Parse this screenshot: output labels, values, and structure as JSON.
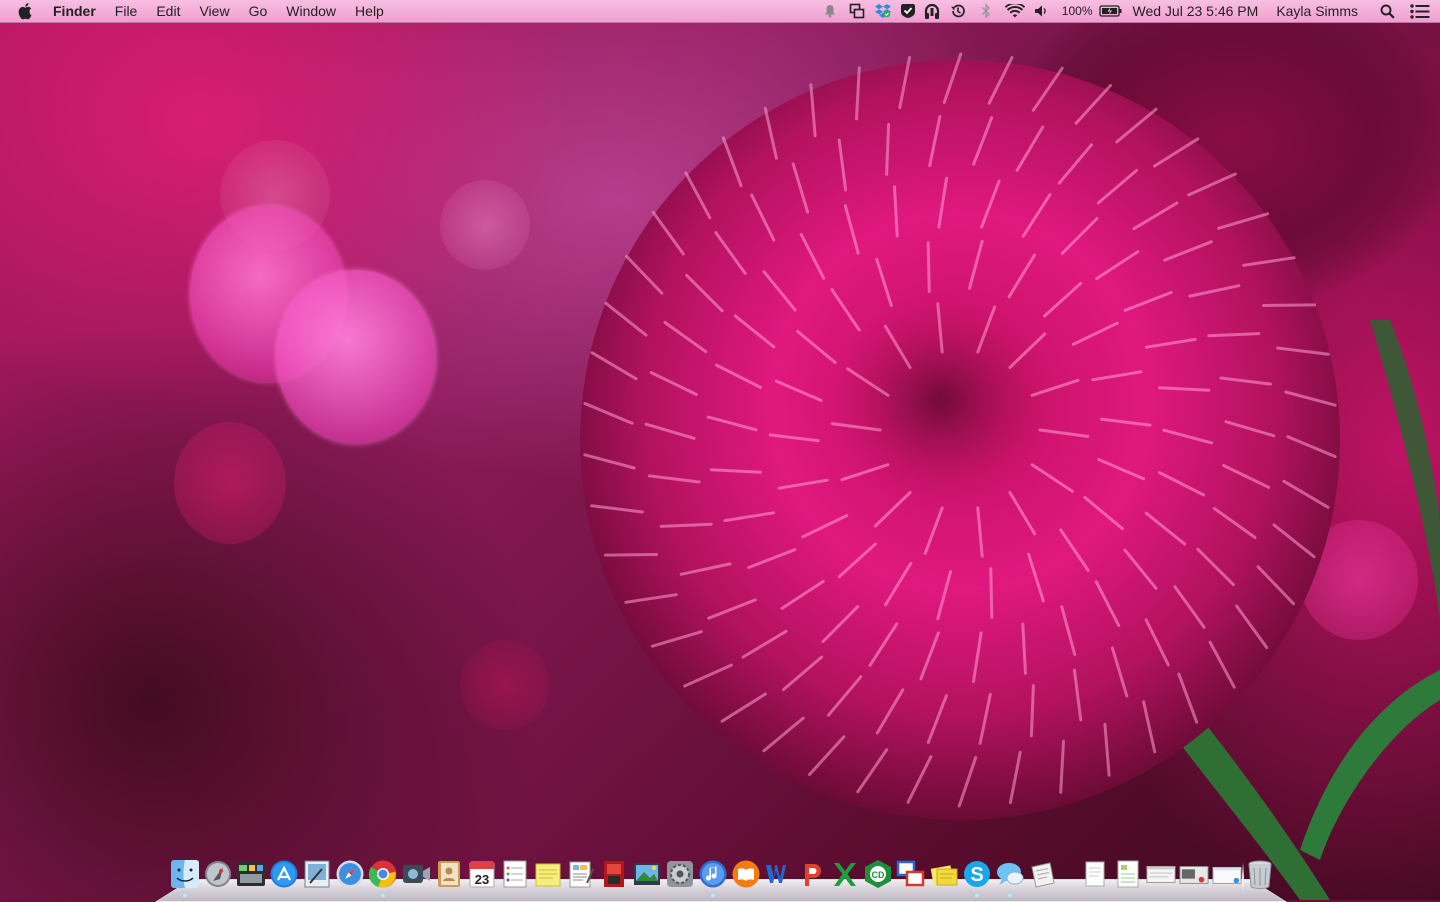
{
  "menubar": {
    "app_name": "Finder",
    "menus": [
      "File",
      "Edit",
      "View",
      "Go",
      "Window",
      "Help"
    ],
    "status": {
      "battery": "100%",
      "datetime": "Wed Jul 23  5:46 PM",
      "user": "Kayla Simms"
    },
    "status_icons": [
      "notification-bell-icon",
      "screen-share-icon",
      "dropbox-icon",
      "check-shield-icon",
      "headphone-app-icon",
      "time-machine-icon",
      "bluetooth-icon",
      "wifi-icon",
      "volume-icon",
      "battery-icon",
      "spotlight-search-icon",
      "notification-center-icon"
    ]
  },
  "calendar_icon_date": "23",
  "colors": {
    "menubar_bg": "#f4b0da",
    "flower_magenta": "#e0187f",
    "flower_dark": "#7a0d3c",
    "stem_green": "#2e7a3a"
  },
  "dock": {
    "apps": [
      {
        "icon": "finder-icon",
        "running": true
      },
      {
        "icon": "launchpad-icon",
        "running": false
      },
      {
        "icon": "mission-control-icon",
        "running": false
      },
      {
        "icon": "app-store-icon",
        "running": false
      },
      {
        "icon": "preview-icon",
        "running": false
      },
      {
        "icon": "safari-icon",
        "running": false
      },
      {
        "icon": "chrome-icon",
        "running": true
      },
      {
        "icon": "facetime-icon",
        "running": false
      },
      {
        "icon": "contacts-icon",
        "running": false
      },
      {
        "icon": "calendar-icon",
        "running": false
      },
      {
        "icon": "reminders-icon",
        "running": false
      },
      {
        "icon": "stickies-icon",
        "running": false
      },
      {
        "icon": "textedit-icon",
        "running": false
      },
      {
        "icon": "photo-booth-icon",
        "running": false
      },
      {
        "icon": "iphoto-icon",
        "running": false
      },
      {
        "icon": "system-preferences-icon",
        "running": false
      },
      {
        "icon": "itunes-icon",
        "running": true
      },
      {
        "icon": "ibooks-icon",
        "running": false
      },
      {
        "icon": "word-icon",
        "running": false
      },
      {
        "icon": "powerpoint-icon",
        "running": false
      },
      {
        "icon": "excel-icon",
        "running": false
      },
      {
        "icon": "cd-burner-icon",
        "running": false
      },
      {
        "icon": "remote-desktop-icon",
        "running": false
      },
      {
        "icon": "notes-folder-icon",
        "running": false
      },
      {
        "icon": "skype-icon",
        "running": true
      },
      {
        "icon": "messages-icon",
        "running": true
      },
      {
        "icon": "script-editor-icon",
        "running": false
      }
    ],
    "documents": [
      {
        "icon": "document-stack-icon"
      },
      {
        "icon": "spreadsheet-stack-icon"
      },
      {
        "icon": "window-stack-icon"
      },
      {
        "icon": "screenshot-stack-icon"
      },
      {
        "icon": "downloads-stack-icon"
      },
      {
        "icon": "trash-icon"
      }
    ]
  }
}
